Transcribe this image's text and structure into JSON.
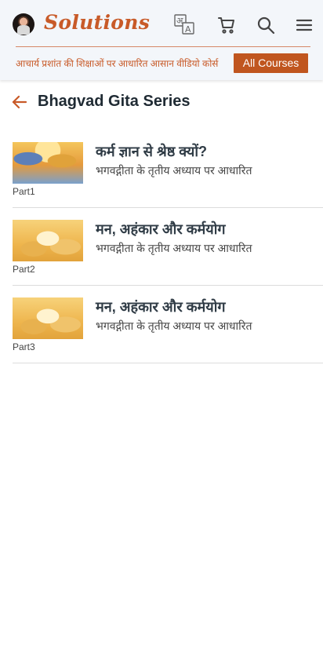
{
  "header": {
    "logo_text": "Solutions",
    "tagline": "आचार्य प्रशांत की शिक्षाओं पर आधारित आसान वीडियो कोर्स",
    "all_courses_label": "All Courses",
    "icons": [
      "avatar",
      "language-icon",
      "cart-icon",
      "search-icon",
      "menu-icon"
    ],
    "accent_color": "#c85a28"
  },
  "page": {
    "title": "Bhagvad Gita Series"
  },
  "items": [
    {
      "part": "Part1",
      "title": "कर्म ज्ञान से श्रेष्ठ क्यों?",
      "subtitle": "भगवद्गीता के तृतीय अध्याय पर आधारित"
    },
    {
      "part": "Part2",
      "title": "मन, अहंकार और कर्मयोग",
      "subtitle": "भगवद्गीता के तृतीय अध्याय पर आधारित"
    },
    {
      "part": "Part3",
      "title": "मन, अहंकार और कर्मयोग",
      "subtitle": "भगवद्गीता के तृतीय अध्याय पर आधारित"
    }
  ]
}
